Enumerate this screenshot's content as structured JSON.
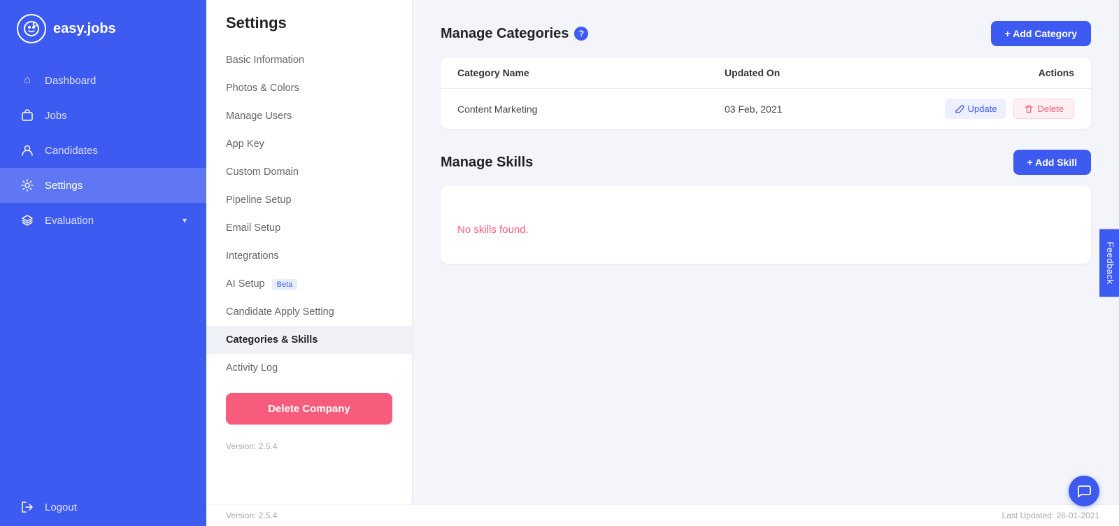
{
  "app": {
    "logo_text": "easy.jobs",
    "logo_icon": "ℹ"
  },
  "sidebar": {
    "items": [
      {
        "id": "dashboard",
        "label": "Dashboard",
        "icon": "⌂",
        "active": false
      },
      {
        "id": "jobs",
        "label": "Jobs",
        "icon": "💼",
        "active": false
      },
      {
        "id": "candidates",
        "label": "Candidates",
        "icon": "👤",
        "active": false
      },
      {
        "id": "settings",
        "label": "Settings",
        "icon": "⚙",
        "active": true
      },
      {
        "id": "evaluation",
        "label": "Evaluation",
        "icon": "🎓",
        "active": false,
        "has_chevron": true
      }
    ],
    "logout": {
      "label": "Logout",
      "icon": "⎋"
    }
  },
  "settings": {
    "title": "Settings",
    "menu": [
      {
        "id": "basic-information",
        "label": "Basic Information",
        "active": false
      },
      {
        "id": "photos-colors",
        "label": "Photos & Colors",
        "active": false
      },
      {
        "id": "manage-users",
        "label": "Manage Users",
        "active": false
      },
      {
        "id": "app-key",
        "label": "App Key",
        "active": false
      },
      {
        "id": "custom-domain",
        "label": "Custom Domain",
        "active": false
      },
      {
        "id": "pipeline-setup",
        "label": "Pipeline Setup",
        "active": false
      },
      {
        "id": "email-setup",
        "label": "Email Setup",
        "active": false
      },
      {
        "id": "integrations",
        "label": "Integrations",
        "active": false
      },
      {
        "id": "ai-setup",
        "label": "AI Setup",
        "active": false,
        "badge": "Beta"
      },
      {
        "id": "candidate-apply-setting",
        "label": "Candidate Apply Setting",
        "active": false
      },
      {
        "id": "categories-skills",
        "label": "Categories & Skills",
        "active": true
      },
      {
        "id": "activity-log",
        "label": "Activity Log",
        "active": false
      }
    ],
    "delete_btn": "Delete Company",
    "version": "Version: 2.5.4"
  },
  "categories_section": {
    "title": "Manage Categories",
    "add_btn": "+ Add Category",
    "table_headers": [
      "Category Name",
      "Updated On",
      "Actions"
    ],
    "rows": [
      {
        "name": "Content Marketing",
        "updated_on": "03 Feb, 2021"
      }
    ],
    "update_btn": "Update",
    "delete_btn": "Delete"
  },
  "skills_section": {
    "title": "Manage Skills",
    "add_btn": "+ Add Skill",
    "no_skills_text": "No skills found."
  },
  "feedback": {
    "label": "Feedback"
  },
  "footer": {
    "version": "Version: 2.5.4",
    "last_updated": "Last Updated: 26-01-2021"
  }
}
